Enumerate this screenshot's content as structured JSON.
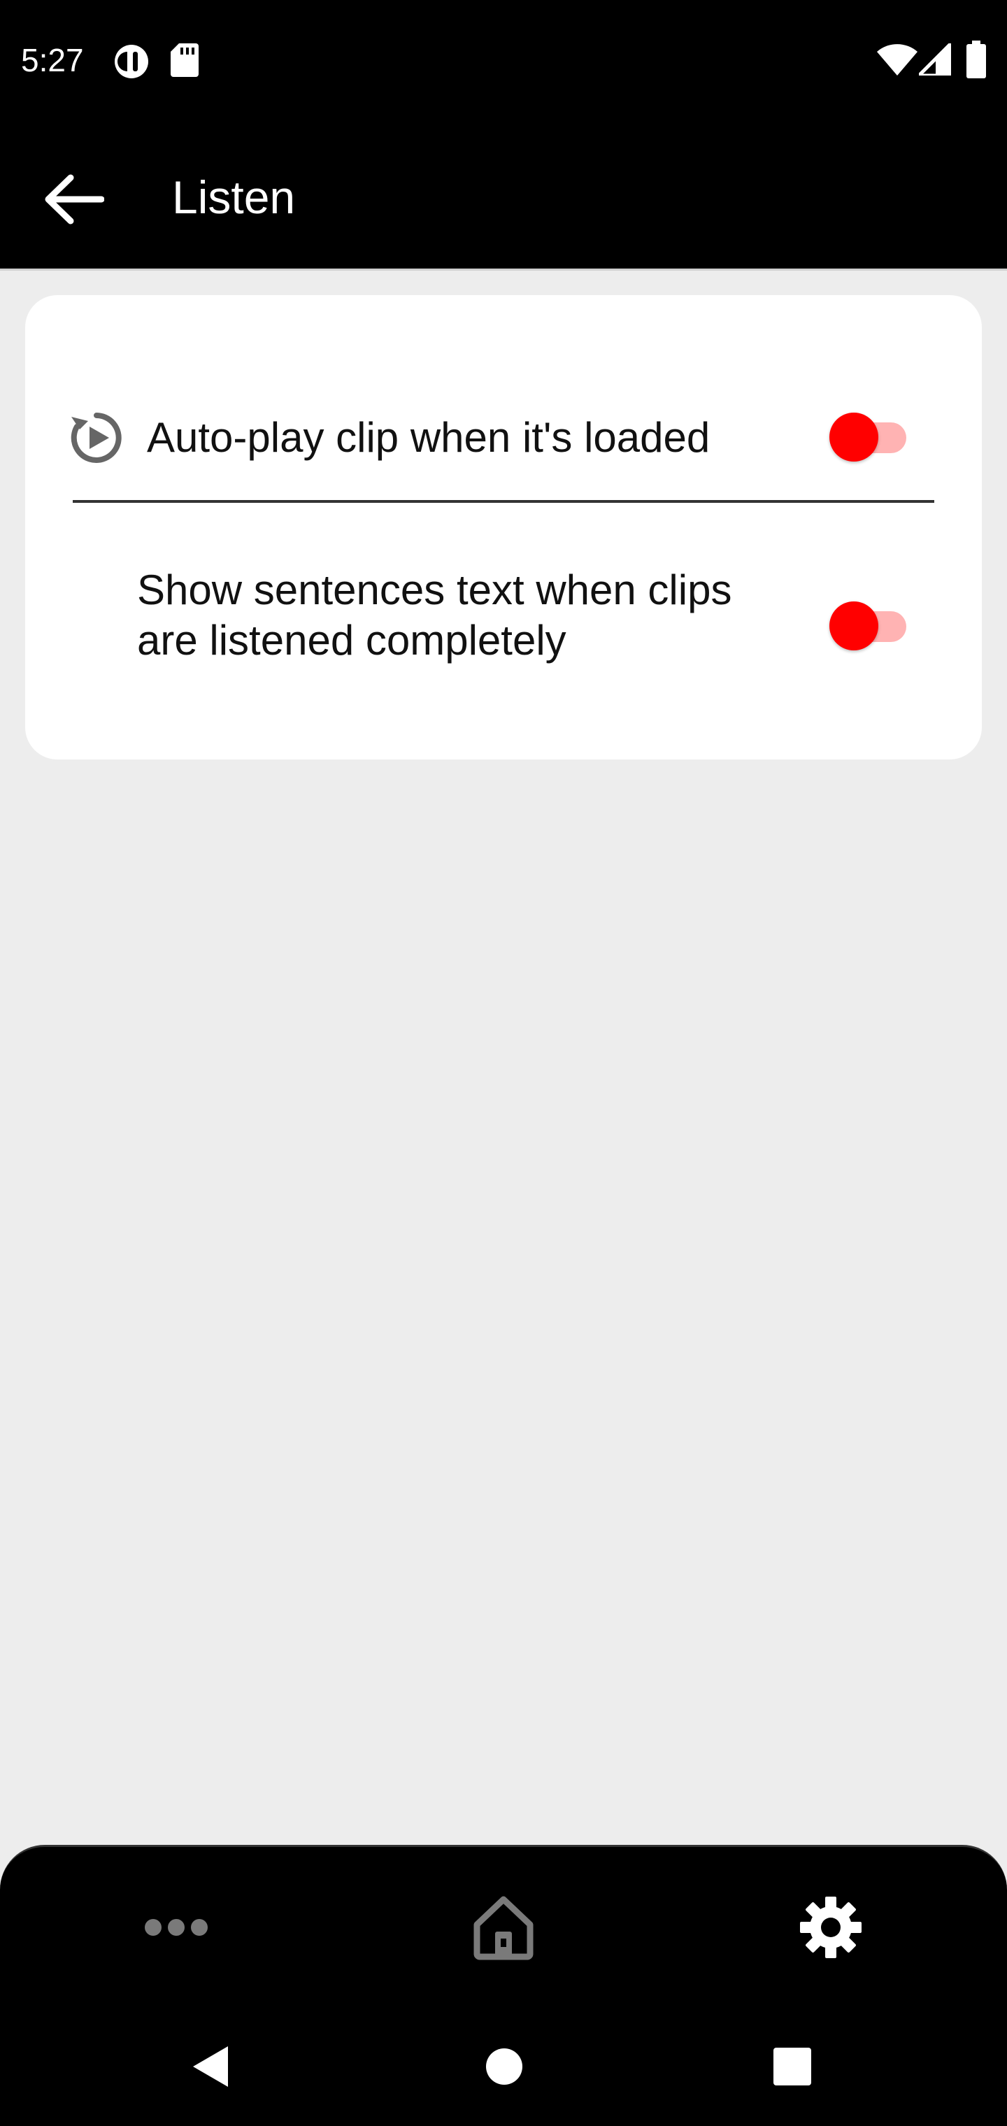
{
  "status_bar": {
    "time": "5:27",
    "left_icons": [
      "data-saver-icon",
      "sd-card-icon"
    ],
    "right_icons": [
      "wifi-icon",
      "cell-signal-icon",
      "battery-icon"
    ]
  },
  "app_bar": {
    "title": "Listen",
    "back_icon": "arrow-back-icon"
  },
  "settings": {
    "items": [
      {
        "label": "Auto-play clip when it's loaded",
        "icon": "autoplay-icon",
        "enabled": true
      },
      {
        "label": "Show sentences text when clips are listened completely",
        "enabled": true
      }
    ]
  },
  "bottom_nav": {
    "items": [
      {
        "icon": "more-horiz-icon",
        "active": false
      },
      {
        "icon": "home-icon",
        "active": false
      },
      {
        "icon": "settings-gear-icon",
        "active": true
      }
    ]
  },
  "system_nav": {
    "items": [
      "back-triangle-icon",
      "home-circle-icon",
      "recents-square-icon"
    ]
  },
  "colors": {
    "background": "#ededed",
    "bar": "#000000",
    "card": "#ffffff",
    "toggle_thumb": "#ff0000",
    "toggle_track": "#ffb3b3",
    "inactive_icon": "#7a7a7a",
    "active_icon": "#ffffff"
  }
}
